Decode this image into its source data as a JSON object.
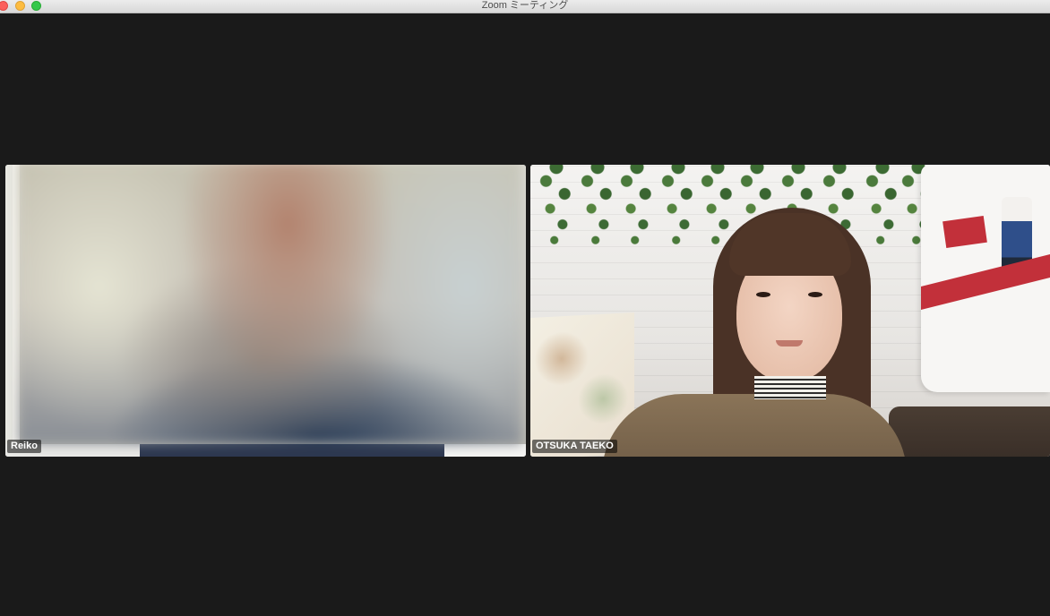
{
  "window": {
    "title": "Zoom ミーティング"
  },
  "participants": [
    {
      "name": "Reiko"
    },
    {
      "name": "OTSUKA TAEKO"
    }
  ]
}
